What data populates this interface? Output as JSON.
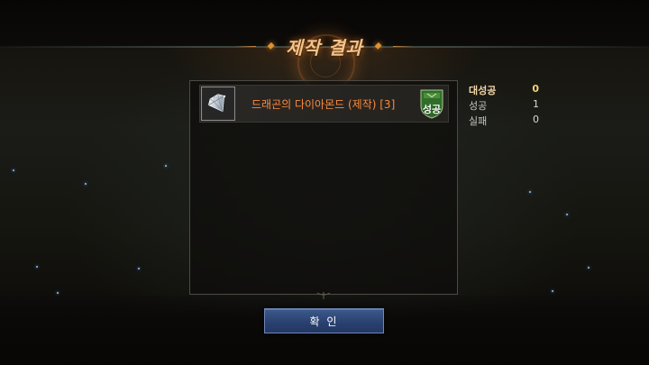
{
  "title": "제작 결과",
  "results": [
    {
      "item_name": "드래곤의 다이아몬드 (제작) [3]",
      "item_icon": "diamond-gem-icon",
      "status": "성공"
    }
  ],
  "stats": [
    {
      "label": "대성공",
      "value": "0",
      "highlight": true
    },
    {
      "label": "성공",
      "value": "1",
      "highlight": false
    },
    {
      "label": "실패",
      "value": "0",
      "highlight": false
    }
  ],
  "confirm_label": "확 인",
  "colors": {
    "title": "#f4c48a",
    "item_name": "#ff8a3a",
    "success_badge": "#2f6f28",
    "highlight_stat": "#f6d27a",
    "confirm_button": "#2a4272"
  }
}
